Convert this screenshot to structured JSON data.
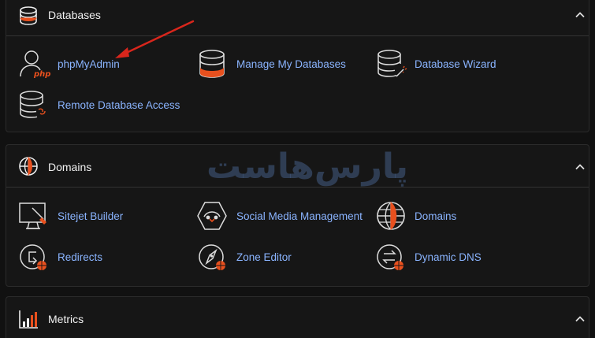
{
  "sections": {
    "databases": {
      "title": "Databases",
      "items": [
        {
          "label": "phpMyAdmin",
          "icon_badge": "php"
        },
        {
          "label": "Manage My Databases"
        },
        {
          "label": "Database Wizard"
        },
        {
          "label": "Remote Database Access"
        }
      ]
    },
    "domains": {
      "title": "Domains",
      "items": [
        {
          "label": "Sitejet Builder"
        },
        {
          "label": "Social Media Management"
        },
        {
          "label": "Domains"
        },
        {
          "label": "Redirects"
        },
        {
          "label": "Zone Editor"
        },
        {
          "label": "Dynamic DNS"
        }
      ]
    },
    "metrics": {
      "title": "Metrics"
    }
  },
  "watermark": {
    "text": "پارس‌هاست"
  },
  "colors": {
    "background": "#111111",
    "panel": "#161616",
    "link": "#8ab4ff",
    "accent": "#e8501e",
    "annotation_arrow": "#d9261c"
  }
}
